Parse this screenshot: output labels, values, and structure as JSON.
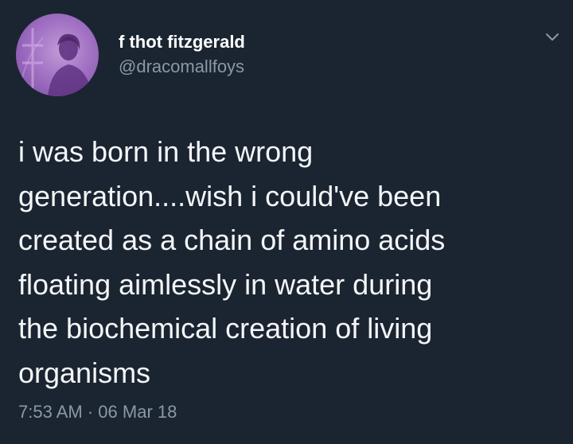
{
  "author": {
    "display_name": "f thot fitzgerald",
    "handle": "@dracomallfoys",
    "avatar": {
      "icon": "profile-avatar-silhouette",
      "color": "#a272c4"
    }
  },
  "tweet": {
    "text": "i was born in the wrong\ngeneration....wish i could've been\ncreated as a chain of amino acids\nfloating aimlessly in water during\nthe biochemical creation of living\norganisms",
    "time": "7:53 AM",
    "separator": "·",
    "date": "06 Mar 18"
  },
  "menu": {
    "icon": "chevron-down-icon"
  },
  "colors": {
    "background": "#1b2531",
    "text": "#f4f6f8",
    "secondary": "#8b98a5"
  }
}
